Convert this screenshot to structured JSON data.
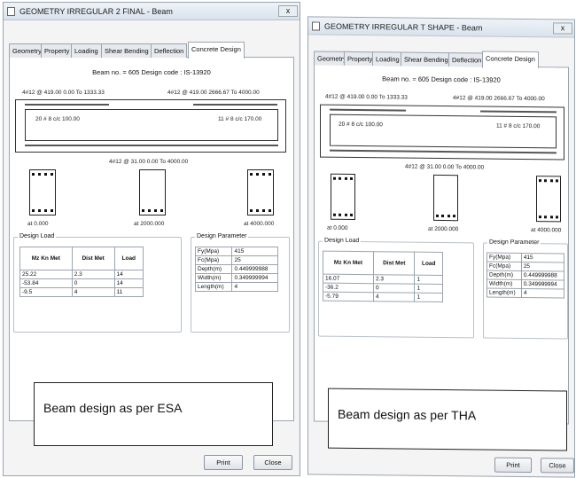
{
  "left": {
    "title": "GEOMETRY IRREGULAR 2 FINAL - Beam",
    "close_glyph": "x",
    "tabs": [
      "Geometry",
      "Property",
      "Loading",
      "Shear Bending",
      "Deflection",
      "Concrete Design"
    ],
    "beam_info": "Beam no. = 605  Design code : IS-13920",
    "top_left_bar": "4#12 @ 419.00 0.00 To 1333.33",
    "top_right_bar": "4#12 @ 419.00 2666.67 To 4000.00",
    "stirrup_left": "20 # 8 c/c 100.00",
    "stirrup_right": "11 # 8 c/c 170.00",
    "bottom_bar": "4#12 @ 31.00 0.00 To 4000.00",
    "section_labels": [
      "at 0.000",
      "at 2000.000",
      "at 4000.000"
    ],
    "design_load_title": "Design Load",
    "load_headers": [
      "Mz Kn Met",
      "Dist Met",
      "Load"
    ],
    "load_rows": [
      [
        "25.22",
        "2.3",
        "14"
      ],
      [
        "-53.84",
        "0",
        "14"
      ],
      [
        "-9.5",
        "4",
        "11"
      ]
    ],
    "param_title": "Design Parameter",
    "params": [
      [
        "Fy(Mpa)",
        "415"
      ],
      [
        "Fc(Mpa)",
        "25"
      ],
      [
        "Depth(m)",
        "0.449999988"
      ],
      [
        "Width(m)",
        "0.349999994"
      ],
      [
        "Length(m)",
        "4"
      ]
    ],
    "caption": "Beam design as per ESA",
    "print": "Print",
    "close": "Close"
  },
  "right": {
    "title": "GEOMETRY IRREGULAR T SHAPE - Beam",
    "close_glyph": "x",
    "tabs": [
      "Geometry",
      "Property",
      "Loading",
      "Shear Bending",
      "Deflection",
      "Concrete Design"
    ],
    "beam_info": "Beam no. = 605  Design code : IS-13920",
    "top_left_bar": "4#12 @ 419.00 0.00 To 1333.33",
    "top_right_bar": "4#12 @ 419.00 2666.67 To 4000.00",
    "stirrup_left": "20 # 8 c/c 100.00",
    "stirrup_right": "11 # 8 c/c 170.00",
    "bottom_bar": "4#12 @ 31.00 0.00 To 4000.00",
    "section_labels": [
      "at 0.000",
      "at 2000.000",
      "at 4000.000"
    ],
    "design_load_title": "Design Load",
    "load_headers": [
      "Mz Kn Met",
      "Dist Met",
      "Load"
    ],
    "load_rows": [
      [
        "16.07",
        "2.3",
        "1"
      ],
      [
        "-36.2",
        "0",
        "1"
      ],
      [
        "-5.79",
        "4",
        "1"
      ]
    ],
    "param_title": "Design Parameter",
    "params": [
      [
        "Fy(Mpa)",
        "415"
      ],
      [
        "Fc(Mpa)",
        "25"
      ],
      [
        "Depth(m)",
        "0.449999988"
      ],
      [
        "Width(m)",
        "0.349999994"
      ],
      [
        "Length(m)",
        "4"
      ]
    ],
    "caption": "Beam design as per THA",
    "print": "Print",
    "close": "Close"
  }
}
